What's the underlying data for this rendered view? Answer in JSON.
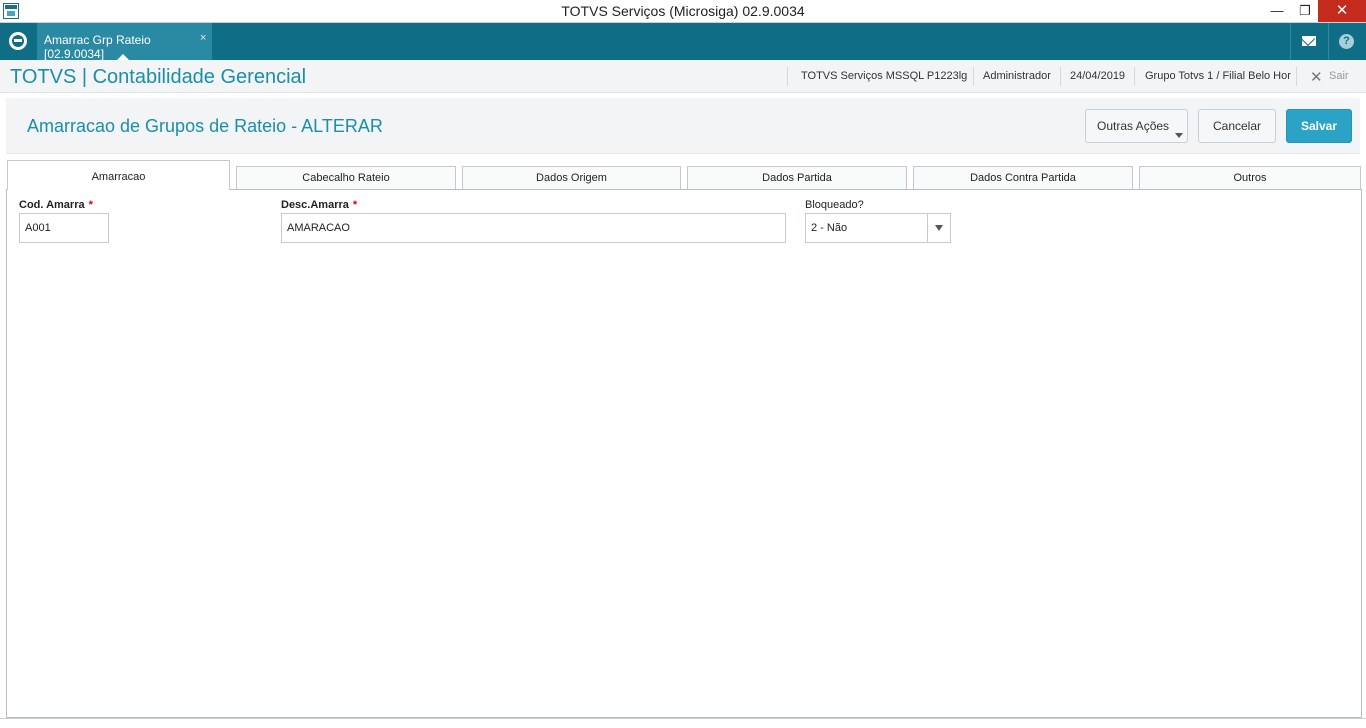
{
  "window": {
    "title": "TOTVS Serviços (Microsiga) 02.9.0034",
    "minimize_glyph": "—",
    "maximize_glyph": "❐",
    "close_glyph": "✕"
  },
  "tabbar": {
    "doc_tab_label": "Amarrac Grp Rateio [02.9.0034]",
    "doc_tab_close": "×",
    "help_glyph": "?"
  },
  "header": {
    "app_title": "TOTVS | Contabilidade Gerencial",
    "environment": "TOTVS Serviços MSSQL P1223lg",
    "user": "Administrador",
    "date": "24/04/2019",
    "company": "Grupo Totvs 1 / Filial Belo Hor",
    "exit_label": "Sair",
    "exit_glyph": "✕"
  },
  "actionbar": {
    "page_title": "Amarracao de Grupos de Rateio - ALTERAR",
    "other_actions_label": "Outras Ações",
    "cancel_label": "Cancelar",
    "save_label": "Salvar"
  },
  "tabs": [
    {
      "label": "Amarracao",
      "active": true
    },
    {
      "label": "Cabecalho Rateio",
      "active": false
    },
    {
      "label": "Dados Origem",
      "active": false
    },
    {
      "label": "Dados Partida",
      "active": false
    },
    {
      "label": "Dados Contra Partida",
      "active": false
    },
    {
      "label": "Outros",
      "active": false
    }
  ],
  "form": {
    "required_mark": "*",
    "cod_amarra": {
      "label": "Cod. Amarra",
      "value": "A001"
    },
    "desc_amarra": {
      "label": "Desc.Amarra",
      "value": "AMARACAO"
    },
    "bloqueado": {
      "label": "Bloqueado?",
      "value": "2 - Não"
    }
  },
  "colors": {
    "brand_teal": "#0f6d86",
    "title_blue": "#1a8eab",
    "save_button": "#2aa3c6",
    "required_red": "#d0021b"
  },
  "icons": [
    "app-window-icon",
    "totvs-logo-icon",
    "mail-icon",
    "help-icon",
    "close-x-icon",
    "dropdown-caret-icon"
  ]
}
